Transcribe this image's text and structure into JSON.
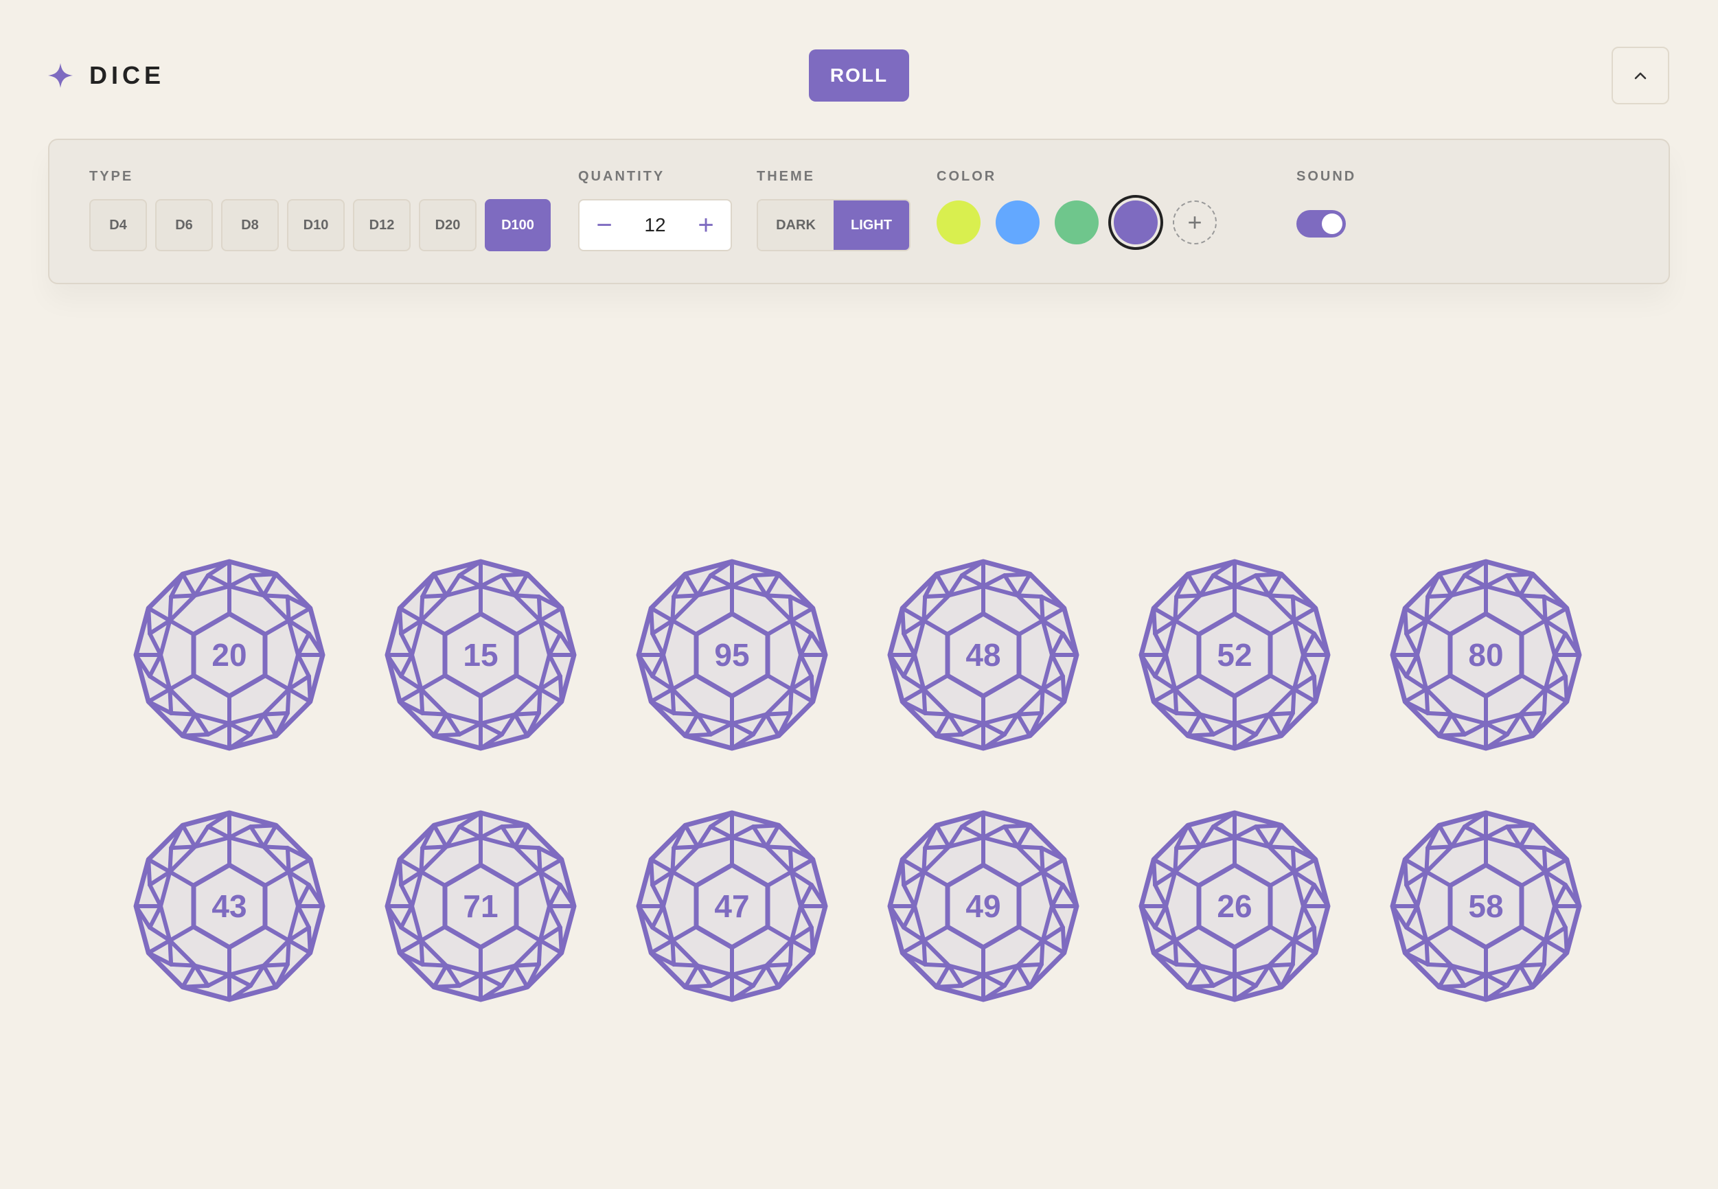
{
  "header": {
    "title": "DICE",
    "roll_label": "ROLL",
    "brand_icon": "sparkle-icon",
    "collapse_icon": "chevron-up-icon"
  },
  "settings": {
    "type": {
      "label": "TYPE",
      "options": [
        "D4",
        "D6",
        "D8",
        "D10",
        "D12",
        "D20",
        "D100"
      ],
      "selected": "D100"
    },
    "quantity": {
      "label": "QUANTITY",
      "value": "12",
      "decrement": "−",
      "increment": "+"
    },
    "theme": {
      "label": "THEME",
      "options": [
        "DARK",
        "LIGHT"
      ],
      "selected": "LIGHT"
    },
    "color": {
      "label": "COLOR",
      "swatches": [
        "#d9ef4f",
        "#63a8ff",
        "#6fc68c",
        "#7e6bc0"
      ],
      "selected": "#7e6bc0",
      "add_label": "+"
    },
    "sound": {
      "label": "SOUND",
      "enabled": true
    }
  },
  "colors": {
    "accent": "#7e6bc0",
    "background": "#f4f0e8",
    "panel": "#ece8e1",
    "die_fill": "#e7e3e4"
  },
  "dice": [
    "20",
    "15",
    "95",
    "48",
    "52",
    "80",
    "43",
    "71",
    "47",
    "49",
    "26",
    "58"
  ]
}
